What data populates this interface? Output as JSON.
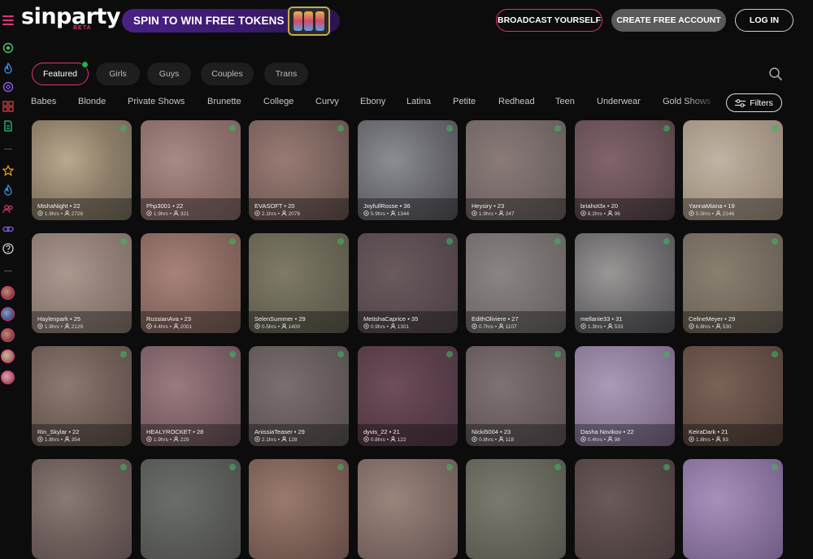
{
  "header": {
    "logo_text": "sinparty",
    "logo_badge": "BETA",
    "promo_text": "SPIN TO WIN FREE TOKENS",
    "broadcast_label": "BROADCAST YOURSELF",
    "create_account_label": "CREATE FREE ACCOUNT",
    "login_label": "LOG IN"
  },
  "sidebar": {
    "icons": [
      "live-icon",
      "fire-icon",
      "vr-icon",
      "grid-icon",
      "document-icon",
      "star-icon",
      "flame-icon",
      "users-icon",
      "link-icon",
      "help-icon"
    ],
    "avatars": [
      "avatar-1",
      "avatar-2",
      "avatar-3",
      "avatar-4",
      "avatar-5"
    ]
  },
  "tabs": [
    {
      "label": "Featured",
      "active": true
    },
    {
      "label": "Girls",
      "active": false
    },
    {
      "label": "Guys",
      "active": false
    },
    {
      "label": "Couples",
      "active": false
    },
    {
      "label": "Trans",
      "active": false
    }
  ],
  "categories": [
    "Babes",
    "Blonde",
    "Private Shows",
    "Brunette",
    "College",
    "Curvy",
    "Ebony",
    "Latina",
    "Petite",
    "Redhead",
    "Teen",
    "Underwear",
    "Gold Shows"
  ],
  "filters_label": "Filters",
  "accent_color": "#e0337a",
  "cards": [
    {
      "name": "MishaNight",
      "age": "22",
      "hours": "1.9hrs",
      "viewers": "2726",
      "colors": [
        "#b9a98f",
        "#8c7d68",
        "#6e6456"
      ]
    },
    {
      "name": "Php3001",
      "age": "22",
      "hours": "1.9hrs",
      "viewers": "321",
      "colors": [
        "#a78a85",
        "#8e6f6c",
        "#75605b"
      ]
    },
    {
      "name": "EVASOFT",
      "age": "20",
      "hours": "2.1hrs",
      "viewers": "2076",
      "colors": [
        "#9a7a72",
        "#7d6560",
        "#5e4a46"
      ]
    },
    {
      "name": "JoyfullRosse",
      "age": "36",
      "hours": "5.9hrs",
      "viewers": "1344",
      "colors": [
        "#8a8e92",
        "#6a6a70",
        "#4e4a50"
      ]
    },
    {
      "name": "Heysiry",
      "age": "23",
      "hours": "1.9hrs",
      "viewers": "247",
      "colors": [
        "#8a7a78",
        "#766a68",
        "#605856"
      ]
    },
    {
      "name": "briahot3x",
      "age": "20",
      "hours": "8.2hrs",
      "viewers": "96",
      "colors": [
        "#80646a",
        "#6a5258",
        "#4a3c40"
      ]
    },
    {
      "name": "YannaMiana",
      "age": "19",
      "hours": "5.5hrs",
      "viewers": "2146",
      "colors": [
        "#c0b4a4",
        "#a89888",
        "#8e8072"
      ]
    },
    {
      "name": "Haylenpark",
      "age": "25",
      "hours": "1.9hrs",
      "viewers": "2129",
      "colors": [
        "#a8988e",
        "#8e7e76",
        "#7a6a62"
      ]
    },
    {
      "name": "RussianAva",
      "age": "23",
      "hours": "4.4hrs",
      "viewers": "2001",
      "colors": [
        "#a8827a",
        "#8a6a62",
        "#6e564e"
      ]
    },
    {
      "name": "SelenSummer",
      "age": "29",
      "hours": "0.5hrs",
      "viewers": "1400",
      "colors": [
        "#7e7a66",
        "#6a6656",
        "#585446"
      ]
    },
    {
      "name": "MetishaCaprice",
      "age": "35",
      "hours": "0.9hrs",
      "viewers": "1301",
      "colors": [
        "#6a5a5e",
        "#5a4c50",
        "#4a3e42"
      ]
    },
    {
      "name": "EdithOliviere",
      "age": "27",
      "hours": "0.7hrs",
      "viewers": "1107",
      "colors": [
        "#8a8482",
        "#767070",
        "#625c5c"
      ]
    },
    {
      "name": "mellanie33",
      "age": "31",
      "hours": "1.3hrs",
      "viewers": "533",
      "colors": [
        "#9a9896",
        "#706e70",
        "#4e4c50"
      ]
    },
    {
      "name": "CelineMeyer",
      "age": "29",
      "hours": "6.8hrs",
      "viewers": "530",
      "colors": [
        "#8a8070",
        "#766c60",
        "#625a50"
      ]
    },
    {
      "name": "Rin_Skylar",
      "age": "22",
      "hours": "1.8hrs",
      "viewers": "354",
      "colors": [
        "#8a7a70",
        "#705f58",
        "#5a4a44"
      ]
    },
    {
      "name": "HEALYROCKET",
      "age": "28",
      "hours": "1.9hrs",
      "viewers": "229",
      "colors": [
        "#9a7a7e",
        "#7e6268",
        "#5e4a50"
      ]
    },
    {
      "name": "AnissiaTeaser",
      "age": "29",
      "hours": "2.1hrs",
      "viewers": "128",
      "colors": [
        "#7a7070",
        "#665c5c",
        "#524a4a"
      ]
    },
    {
      "name": "dyvis_22",
      "age": "21",
      "hours": "0.8hrs",
      "viewers": "122",
      "colors": [
        "#6e4e5a",
        "#5a3e4a",
        "#4a3240"
      ]
    },
    {
      "name": "Nicki5004",
      "age": "23",
      "hours": "0.8hrs",
      "viewers": "118",
      "colors": [
        "#7e7274",
        "#6a5e60",
        "#564c4e"
      ]
    },
    {
      "name": "Dasha Novikov",
      "age": "22",
      "hours": "0.4hrs",
      "viewers": "98",
      "colors": [
        "#a89ab8",
        "#8e7e9c",
        "#725e7c"
      ]
    },
    {
      "name": "KeiraDark",
      "age": "21",
      "hours": "1.8hrs",
      "viewers": "93",
      "colors": [
        "#7a6256",
        "#644e46",
        "#4e3c36"
      ]
    },
    {
      "name": "",
      "age": "",
      "hours": "",
      "viewers": "",
      "colors": [
        "#8a7a74",
        "#6e5e5a",
        "#56484a"
      ]
    },
    {
      "name": "",
      "age": "",
      "hours": "",
      "viewers": "",
      "colors": [
        "#6a6e6a",
        "#5a5c58",
        "#4a4a48"
      ]
    },
    {
      "name": "",
      "age": "",
      "hours": "",
      "viewers": "",
      "colors": [
        "#9a7a6e",
        "#7e6258",
        "#624a44"
      ]
    },
    {
      "name": "",
      "age": "",
      "hours": "",
      "viewers": "",
      "colors": [
        "#9a847c",
        "#806c66",
        "#665452"
      ]
    },
    {
      "name": "",
      "age": "",
      "hours": "",
      "viewers": "",
      "colors": [
        "#7a7a6e",
        "#66665c",
        "#52524a"
      ]
    },
    {
      "name": "",
      "age": "",
      "hours": "",
      "viewers": "",
      "colors": [
        "#6a5a5a",
        "#584848",
        "#463a3a"
      ]
    },
    {
      "name": "",
      "age": "",
      "hours": "",
      "viewers": "",
      "colors": [
        "#a890b8",
        "#8c76a0",
        "#6e5a82"
      ]
    }
  ]
}
